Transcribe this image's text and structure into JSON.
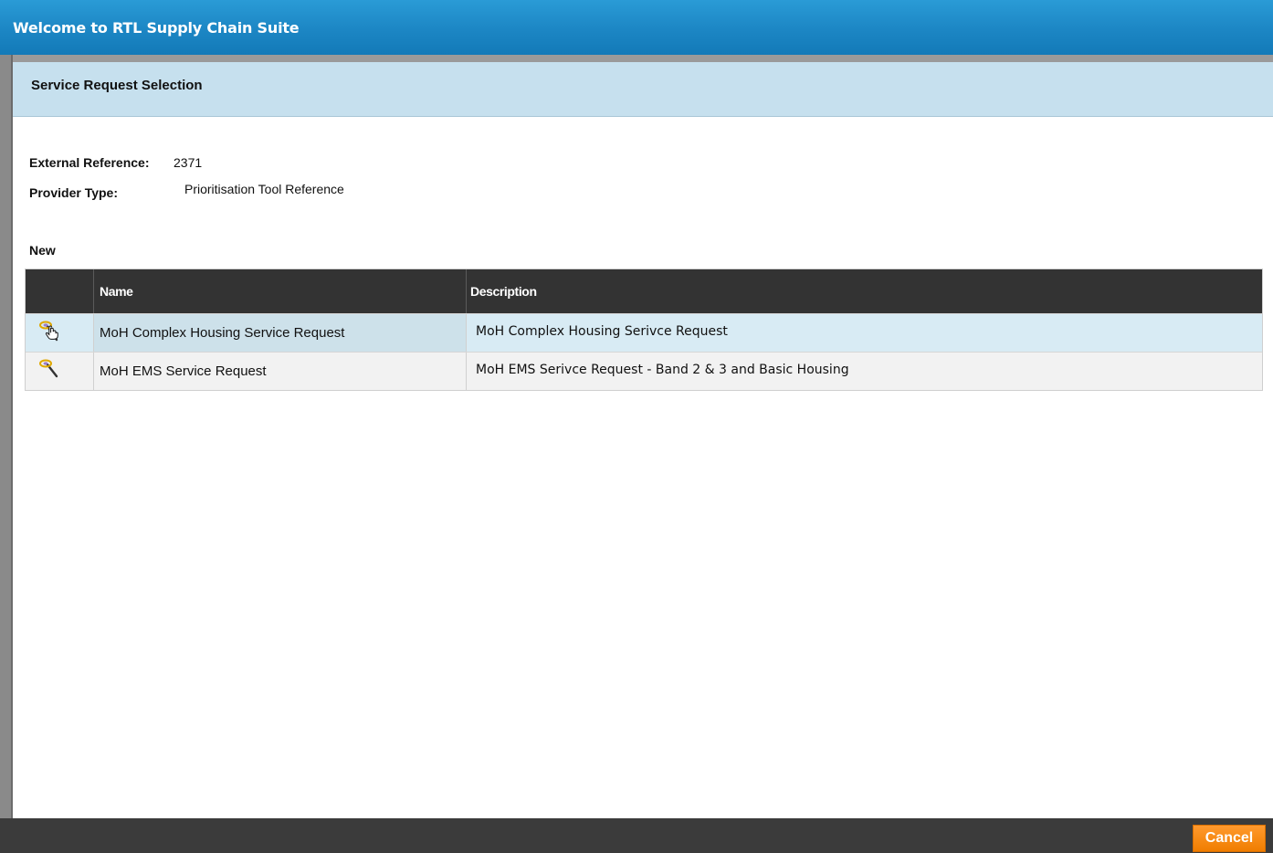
{
  "window": {
    "title": "Welcome to RTL Supply Chain Suite"
  },
  "section": {
    "title": "Service Request Selection"
  },
  "info": {
    "external_reference_label": "External Reference:",
    "external_reference_value": "2371",
    "provider_type_label": "Provider Type:",
    "provider_type_value": "Prioritisation Tool Reference"
  },
  "list": {
    "heading": "New",
    "columns": {
      "name": "Name",
      "description": "Description"
    },
    "rows": [
      {
        "name": "MoH Complex Housing Service Request",
        "description": "MoH Complex Housing Serivce Request",
        "icon": "magic-wand-icon"
      },
      {
        "name": "MoH EMS Service Request",
        "description": "MoH EMS Serivce Request - Band 2 & 3 and Basic Housing",
        "icon": "magic-wand-icon"
      }
    ]
  },
  "footer": {
    "cancel_label": "Cancel"
  },
  "colors": {
    "titlebar": "#1c86c4",
    "section_header": "#c6e0ee",
    "grid_header": "#333333",
    "selected_row": "#d8ebf4",
    "cancel_button": "#f7890f"
  }
}
